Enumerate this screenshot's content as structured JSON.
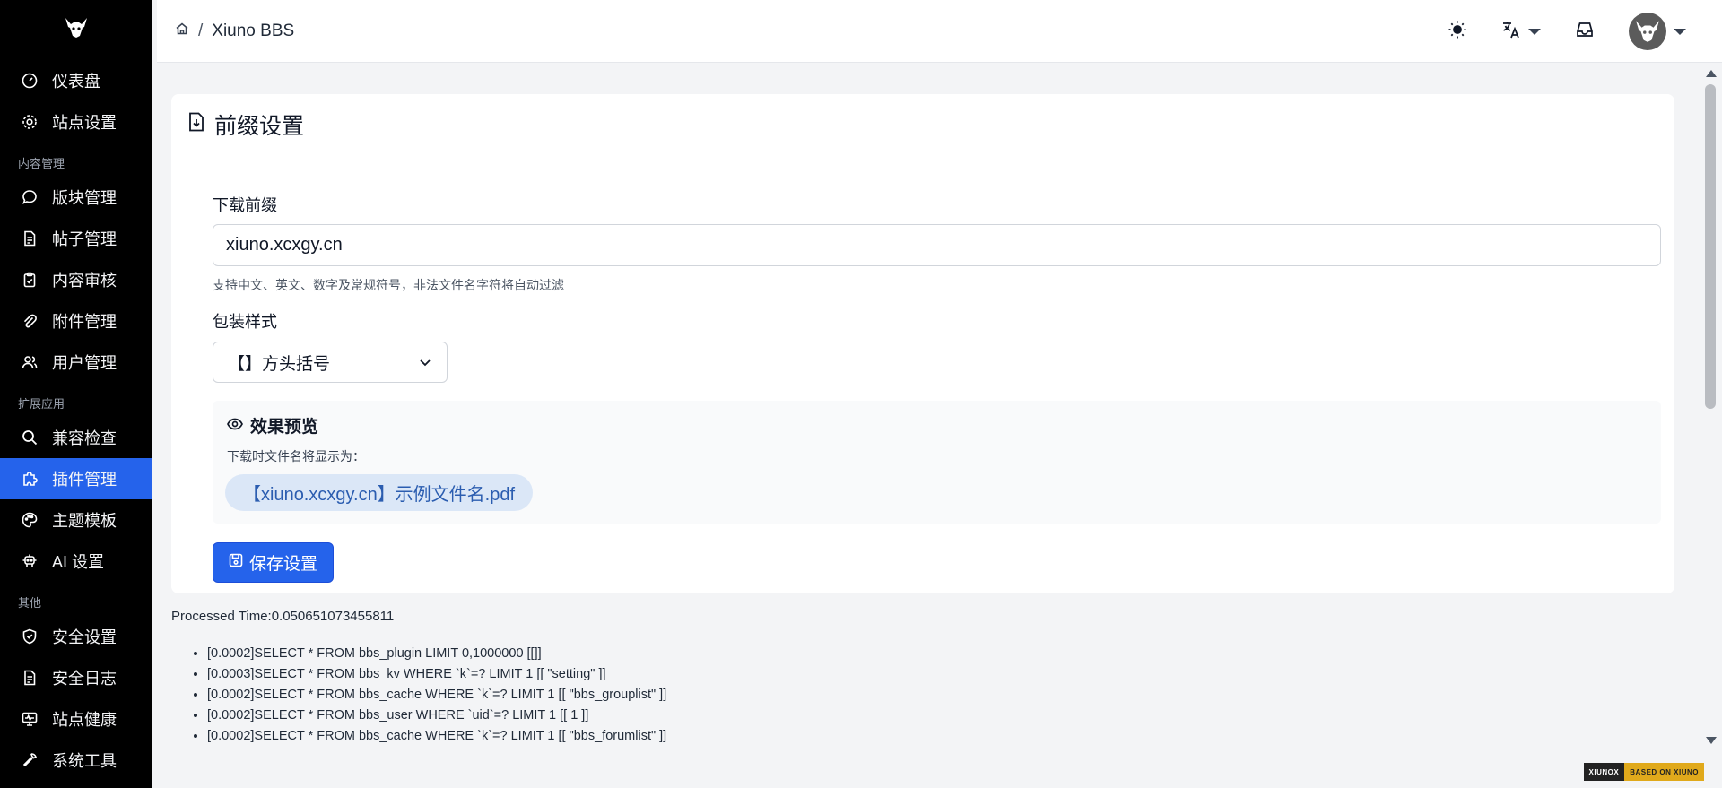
{
  "breadcrumb": {
    "current": "Xiuno BBS",
    "separator": "/"
  },
  "sidebar": {
    "items_top": [
      {
        "label": "仪表盘",
        "icon": "gauge-icon"
      },
      {
        "label": "站点设置",
        "icon": "gear-icon"
      }
    ],
    "section_content": "内容管理",
    "items_content": [
      {
        "label": "版块管理",
        "icon": "chat-bubble-icon"
      },
      {
        "label": "帖子管理",
        "icon": "document-icon"
      },
      {
        "label": "内容审核",
        "icon": "clipboard-check-icon"
      },
      {
        "label": "附件管理",
        "icon": "paperclip-icon"
      },
      {
        "label": "用户管理",
        "icon": "users-icon"
      }
    ],
    "section_extend": "扩展应用",
    "items_extend": [
      {
        "label": "兼容检查",
        "icon": "search-icon"
      },
      {
        "label": "插件管理",
        "icon": "puzzle-icon",
        "active": true
      },
      {
        "label": "主题模板",
        "icon": "palette-icon"
      },
      {
        "label": "AI 设置",
        "icon": "robot-icon"
      }
    ],
    "section_other": "其他",
    "items_other": [
      {
        "label": "安全设置",
        "icon": "shield-icon"
      },
      {
        "label": "安全日志",
        "icon": "log-document-icon"
      },
      {
        "label": "站点健康",
        "icon": "monitor-icon"
      },
      {
        "label": "系统工具",
        "icon": "tool-icon"
      }
    ]
  },
  "card": {
    "title": "前缀设置",
    "prefix_label": "下载前缀",
    "prefix_value": "xiuno.xcxgy.cn",
    "prefix_help": "支持中文、英文、数字及常规符号，非法文件名字符将自动过滤",
    "style_label": "包装样式",
    "style_value": "【】方头括号",
    "preview_title": "效果预览",
    "preview_hint": "下载时文件名将显示为：",
    "preview_filename": "【xiuno.xcxgy.cn】示例文件名.pdf",
    "save_label": "保存设置"
  },
  "debug": {
    "processed_time": "Processed Time:0.050651073455811",
    "queries": [
      "[0.0002]SELECT * FROM bbs_plugin LIMIT 0,1000000 [[]]",
      "[0.0003]SELECT * FROM bbs_kv WHERE `k`=? LIMIT 1 [[ \"setting\" ]]",
      "[0.0002]SELECT * FROM bbs_cache WHERE `k`=? LIMIT 1 [[ \"bbs_grouplist\" ]]",
      "[0.0002]SELECT * FROM bbs_user WHERE `uid`=? LIMIT 1 [[ 1 ]]",
      "[0.0002]SELECT * FROM bbs_cache WHERE `k`=? LIMIT 1 [[ \"bbs_forumlist\" ]]"
    ]
  },
  "badge": {
    "left": "XIUNOX",
    "right": "BASED ON XIUNO"
  },
  "colors": {
    "sidebar_bg": "#000000",
    "accent": "#2563eb",
    "preview_pill_bg": "#dbe7f7",
    "preview_text": "#2b5db0"
  }
}
